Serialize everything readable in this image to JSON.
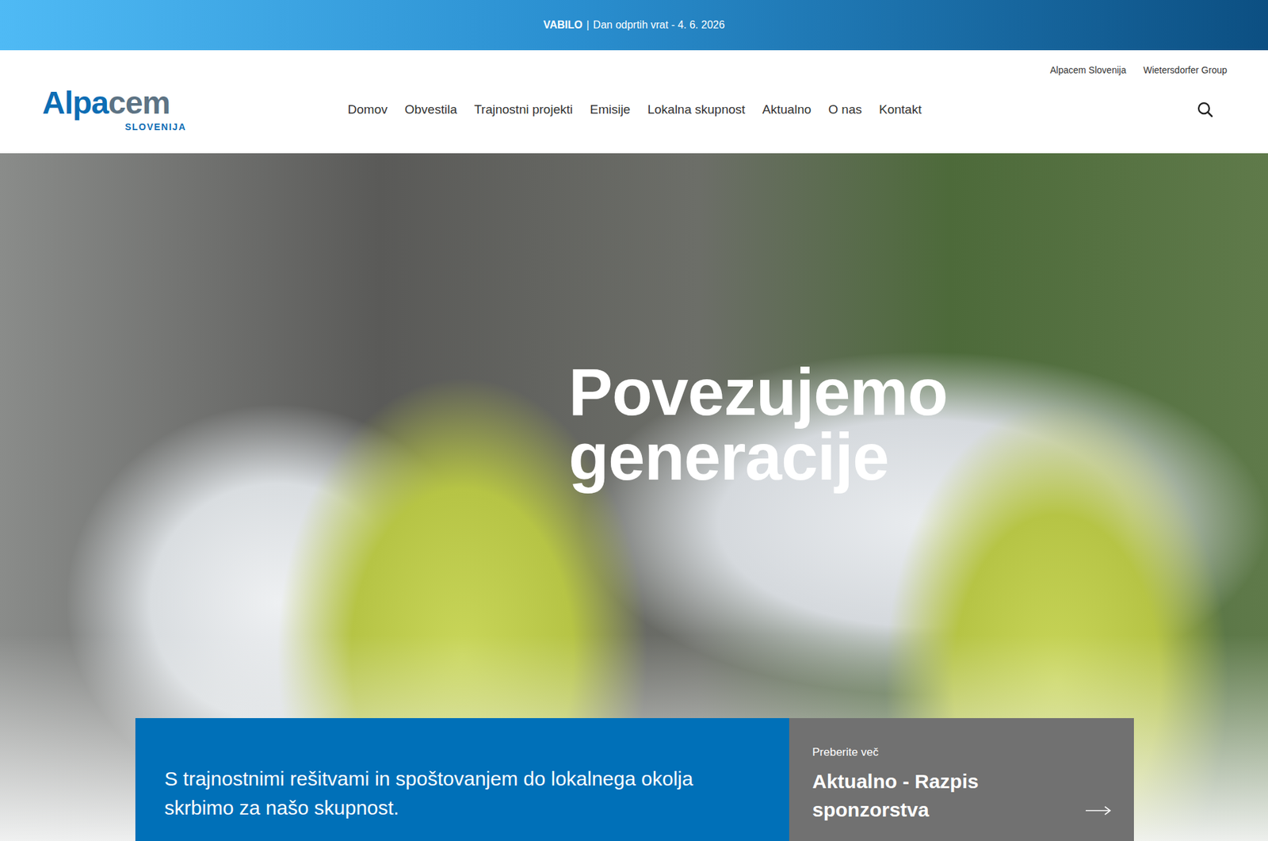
{
  "announcement": {
    "strong": "VABILO",
    "separator": "|",
    "text": "Dan odprtih vrat - 4. 6. 2026"
  },
  "logo": {
    "parts": [
      {
        "text": "Alpa",
        "color": "#0d6db4"
      },
      {
        "text": "cem",
        "color": "#5d7384"
      }
    ],
    "sub": "SLOVENIJA"
  },
  "utility_links": [
    "Alpacem Slovenija",
    "Wietersdorfer Group"
  ],
  "nav": [
    {
      "label": "Domov",
      "selected": false
    },
    {
      "label": "Obvestila",
      "selected": false
    },
    {
      "label": "Trajnostni projekti",
      "selected": false
    },
    {
      "label": "Emisije",
      "selected": false
    },
    {
      "label": "Lokalna skupnost",
      "selected": false
    },
    {
      "label": "Aktualno",
      "selected": false
    },
    {
      "label": "O nas",
      "selected": false
    },
    {
      "label": "Kontakt",
      "selected": false
    }
  ],
  "hero": {
    "headline": [
      "Povezujemo",
      "generacije"
    ]
  },
  "intro_box": {
    "text": "S trajnostnimi rešitvami in spoštovanjem do lokalnega okolja skrbimo za našo skupnost."
  },
  "teaser_box": {
    "kicker": "Preberite več",
    "title": "Aktualno - Razpis sponzorstva"
  }
}
